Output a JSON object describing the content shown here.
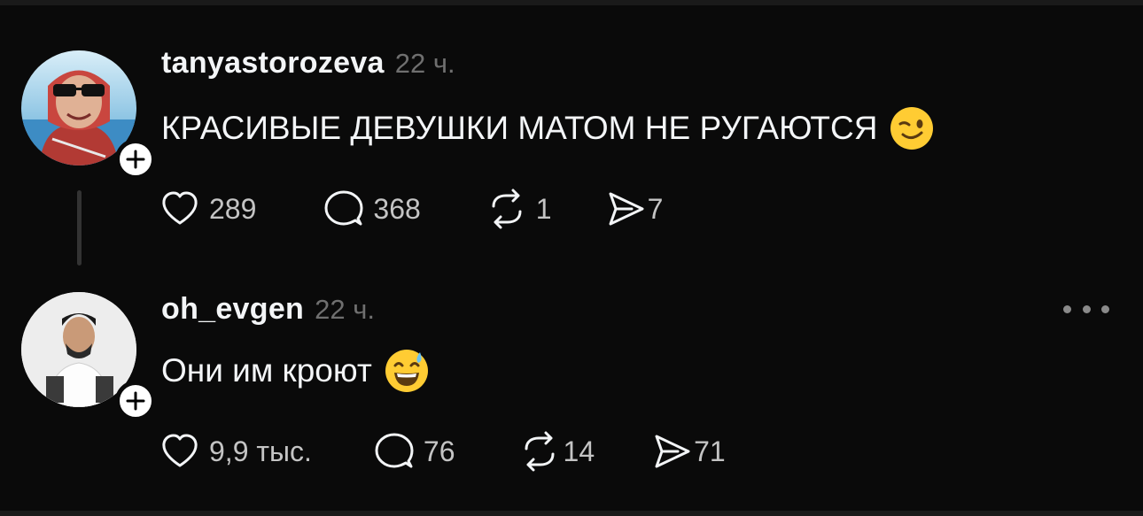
{
  "comments": [
    {
      "username": "tanyastorozeva",
      "time": "22 ч.",
      "text": "КРАСИВЫЕ ДЕВУШКИ МАТОМ НЕ РУГАЮТСЯ",
      "emoji": "winking-face",
      "likes": "289",
      "replies": "368",
      "reposts": "1",
      "shares": "7"
    },
    {
      "username": "oh_evgen",
      "time": "22 ч.",
      "text": "Они им кроют",
      "emoji": "grinning-face-with-sweat",
      "likes": "9,9 тыс.",
      "replies": "76",
      "reposts": "14",
      "shares": "71"
    }
  ],
  "colors": {
    "background": "#0a0a0a",
    "text": "#f3f5f7",
    "secondary": "#6f6f6f"
  }
}
